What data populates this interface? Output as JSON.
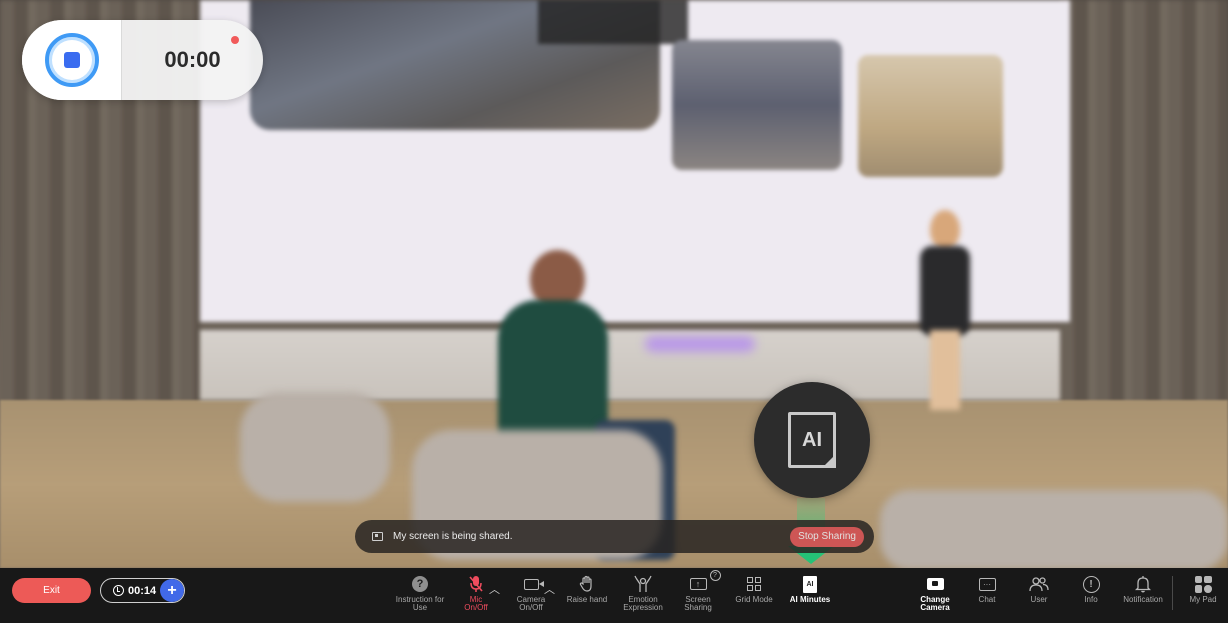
{
  "recorder": {
    "time": "00:00"
  },
  "share_bar": {
    "message": "My screen is being shared.",
    "stop_label": "Stop Sharing"
  },
  "ai_bubble": {
    "label": "AI"
  },
  "toolbar": {
    "exit_label": "Exit",
    "timer": "00:14",
    "add_symbol": "+",
    "items": [
      {
        "id": "instruction",
        "label_line1": "Instruction for",
        "label_line2": "Use",
        "icon": "help-icon"
      },
      {
        "id": "mic",
        "label_line1": "Mic",
        "label_line2": "On/Off",
        "icon": "mic-muted-icon",
        "state": "off"
      },
      {
        "id": "camera",
        "label_line1": "Camera",
        "label_line2": "On/Off",
        "icon": "camera-icon"
      },
      {
        "id": "raise-hand",
        "label_line1": "Raise hand",
        "icon": "hand-icon"
      },
      {
        "id": "emotion",
        "label_line1": "Emotion",
        "label_line2": "Expression",
        "icon": "emotion-icon"
      },
      {
        "id": "screen-sharing",
        "label_line1": "Screen",
        "label_line2": "Sharing",
        "icon": "screen-share-icon",
        "badge": "?"
      },
      {
        "id": "grid-mode",
        "label_line1": "Grid Mode",
        "icon": "grid-icon"
      },
      {
        "id": "ai-minutes",
        "label_line1": "AI Minutes",
        "icon": "ai-document-icon",
        "icon_text": "AI"
      },
      {
        "id": "change-camera",
        "label_line1": "Change",
        "label_line2": "Camera",
        "icon": "change-camera-icon"
      },
      {
        "id": "chat",
        "label_line1": "Chat",
        "icon": "chat-icon"
      },
      {
        "id": "user",
        "label_line1": "User",
        "icon": "users-icon"
      },
      {
        "id": "info",
        "label_line1": "Info",
        "icon": "info-icon"
      },
      {
        "id": "notification",
        "label_line1": "Notification",
        "icon": "bell-icon"
      },
      {
        "id": "my-pad",
        "label_line1": "My Pad",
        "icon": "pad-icon"
      }
    ]
  },
  "colors": {
    "exit": "#ed5a57",
    "add": "#4169e8",
    "mic_off": "#ef4c5e",
    "pointer": "#25c277",
    "record_ring": "#3f9af5"
  }
}
